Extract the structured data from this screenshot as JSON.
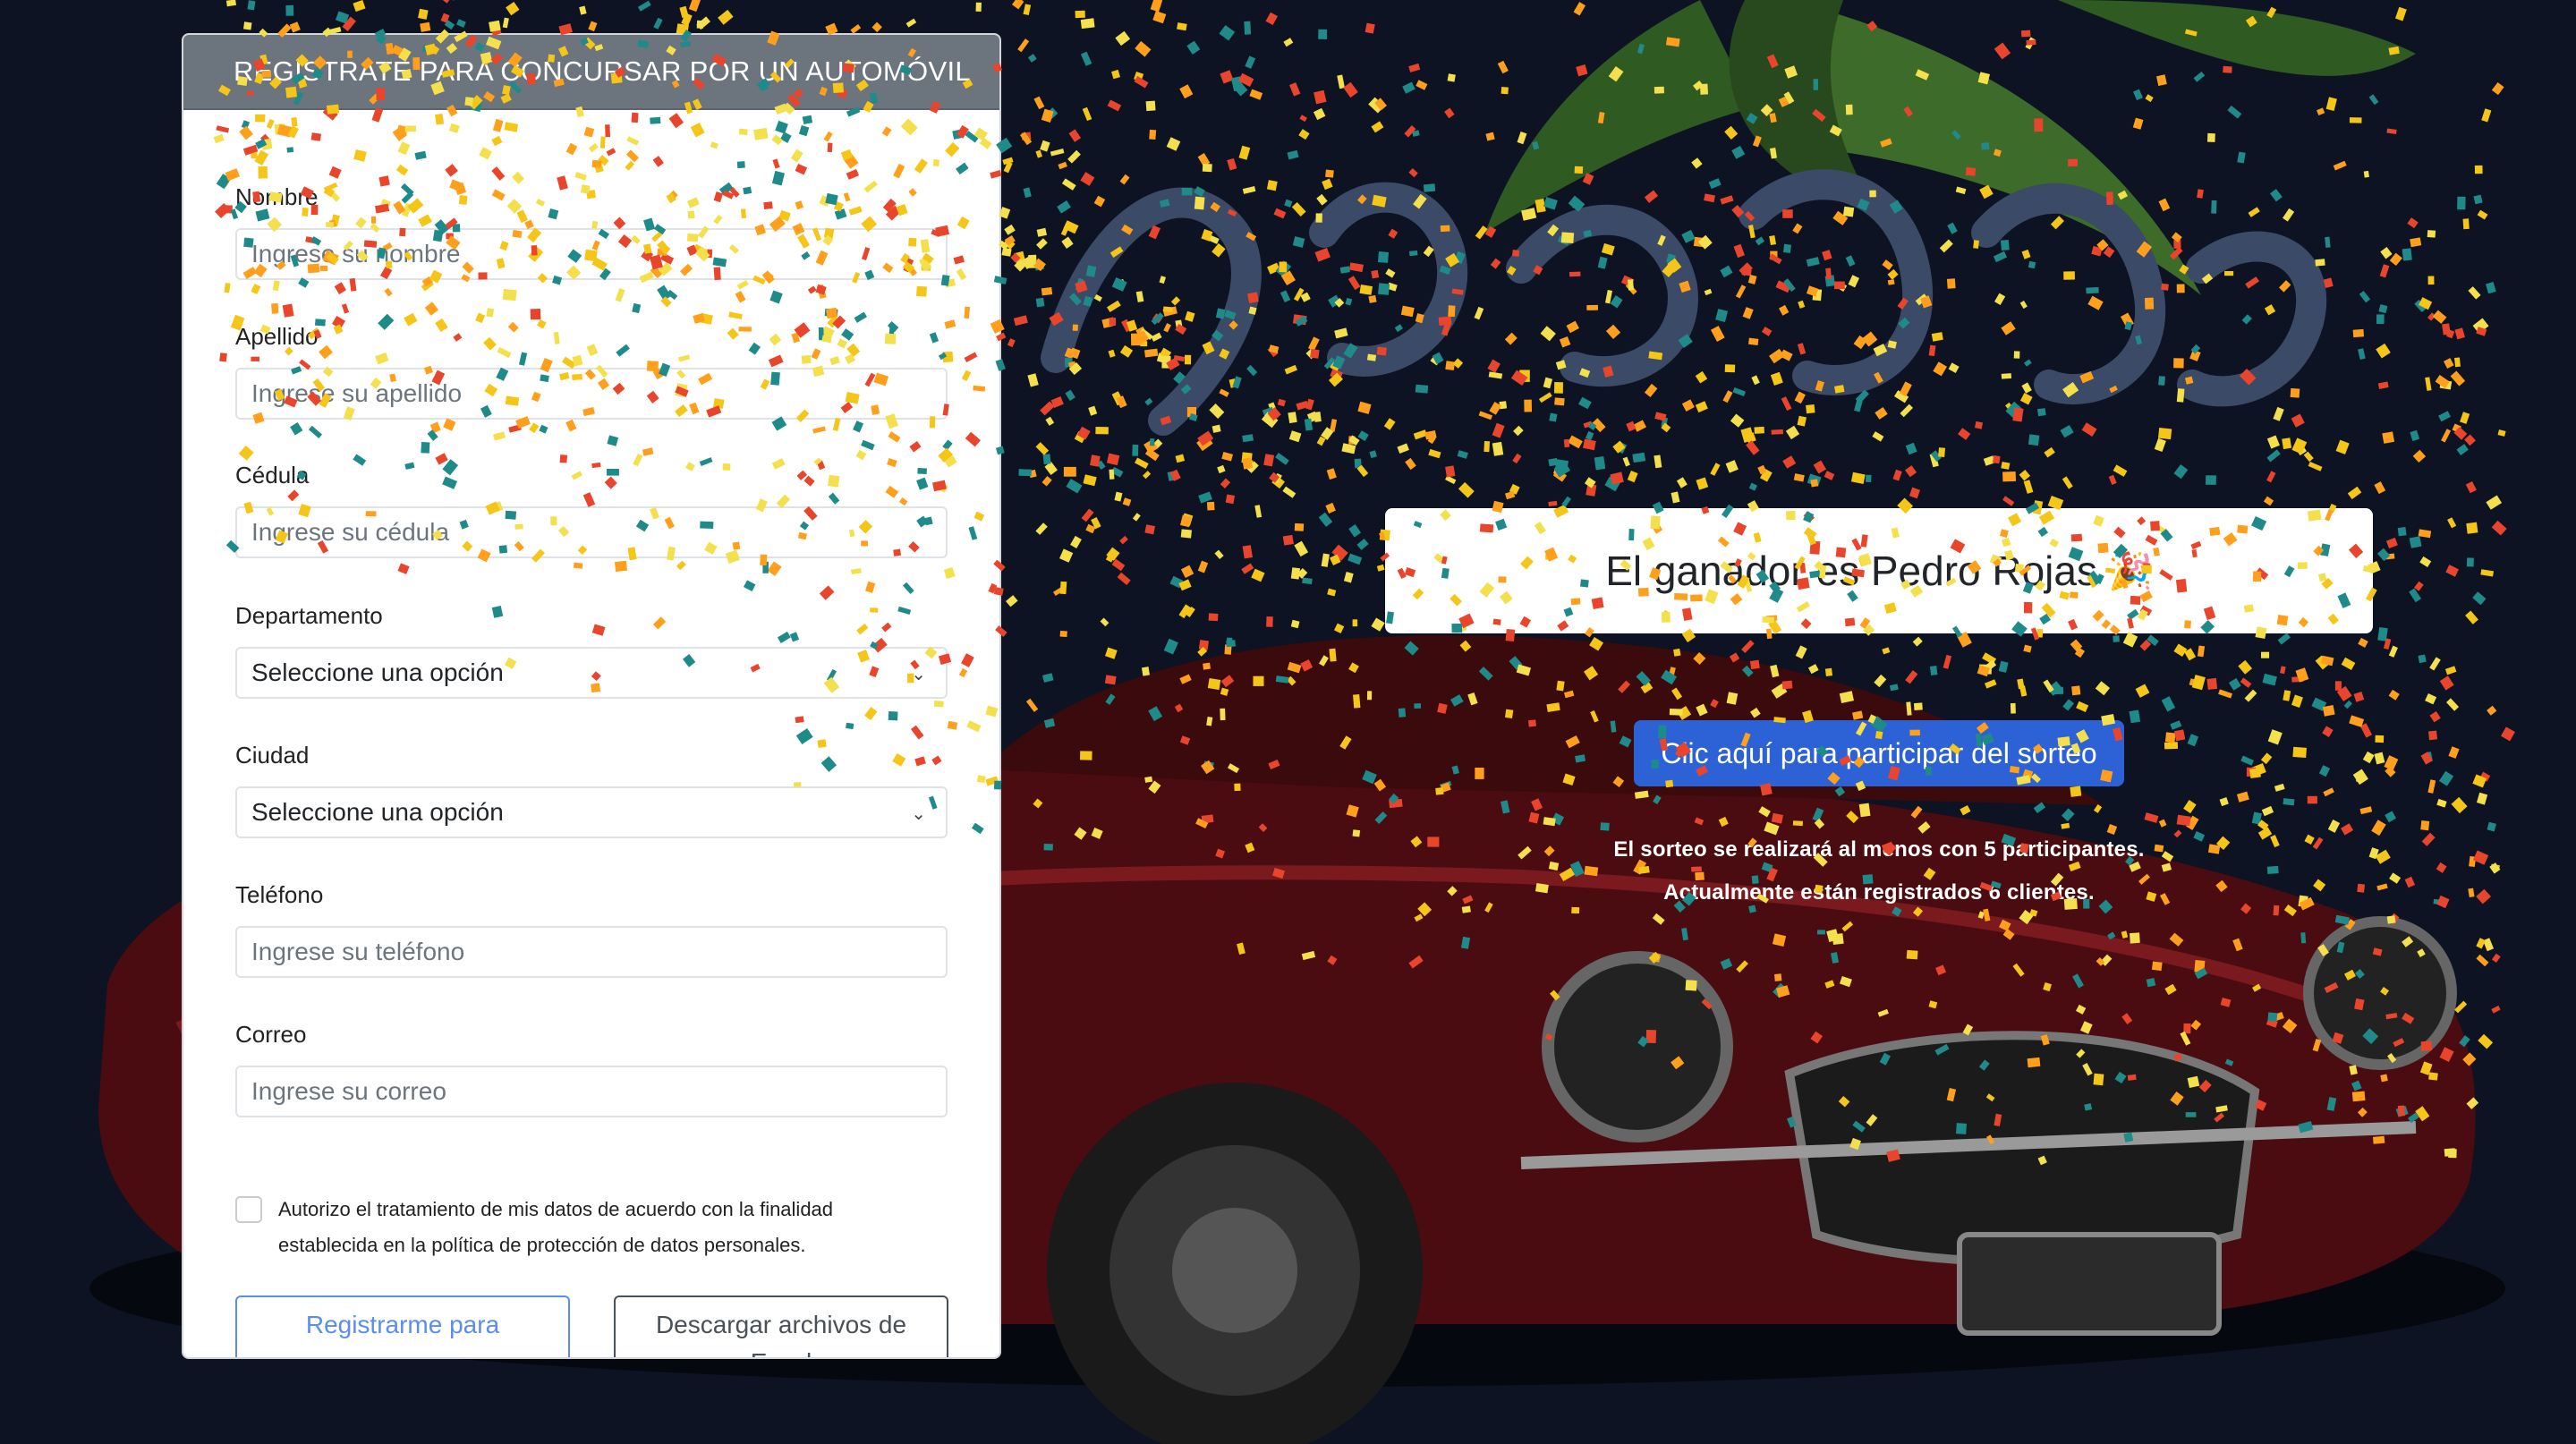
{
  "form": {
    "header": "REGÍSTRATE PARA CONCURSAR POR UN AUTOMÓVIL",
    "fields": [
      {
        "label": "Nombre",
        "placeholder": "Ingrese su nombre"
      },
      {
        "label": "Apellido",
        "placeholder": "Ingrese su apellido"
      },
      {
        "label": "Cédula",
        "placeholder": "Ingrese su cédula"
      },
      {
        "label": "Departamento",
        "selected": "Seleccione una opción"
      },
      {
        "label": "Ciudad",
        "selected": "Seleccione una opción"
      },
      {
        "label": "Teléfono",
        "placeholder": "Ingrese su teléfono"
      },
      {
        "label": "Correo",
        "placeholder": "Ingrese su correo"
      }
    ],
    "consent": "Autorizo el tratamiento de mis datos de acuerdo con la finalidad establecida en la política de protección de datos personales.",
    "register_button": "Registrarme para concursar",
    "excel_button": "Descargar archivos de Excel"
  },
  "winner": {
    "text": "El ganador es Pedro Rojas",
    "emoji": "🎉"
  },
  "cta_button": "Clic aquí para participar del sorteo",
  "info": {
    "line1": "El sorteo se realizará al menos con 5 participantes.",
    "line2": "Actualmente están registrados 6 clientes."
  },
  "colors": {
    "page_background": "#0d1322",
    "card_header": "#6c757d",
    "primary": "#2d62d6",
    "confetti": [
      "#e8452c",
      "#f5c518",
      "#1f8a8a",
      "#ff9f1c",
      "#f4e04d"
    ]
  }
}
